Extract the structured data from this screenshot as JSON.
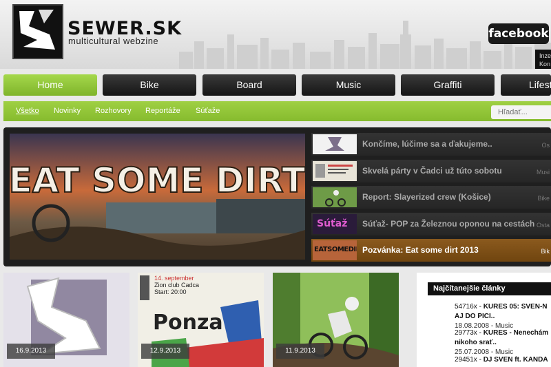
{
  "header": {
    "logo_title": "SEWER.SK",
    "logo_subtitle": "multicultural webzine",
    "facebook_label": "facebook",
    "side_tab_lines": [
      "Inze",
      "Kon"
    ]
  },
  "nav": {
    "items": [
      {
        "label": "Home",
        "active": true
      },
      {
        "label": "Bike",
        "active": false
      },
      {
        "label": "Board",
        "active": false
      },
      {
        "label": "Music",
        "active": false
      },
      {
        "label": "Graffiti",
        "active": false
      },
      {
        "label": "Lifest",
        "active": false
      }
    ]
  },
  "subnav": {
    "items": [
      {
        "label": "Všetko",
        "active": true
      },
      {
        "label": "Novinky",
        "active": false
      },
      {
        "label": "Rozhovory",
        "active": false
      },
      {
        "label": "Reportáže",
        "active": false
      },
      {
        "label": "Súťaže",
        "active": false
      }
    ],
    "search_placeholder": "Hľadať..."
  },
  "featured": {
    "image_text": "EAT SOME DIRT",
    "items": [
      {
        "title": "Končíme, lúčime sa a ďakujeme..",
        "category": "Os",
        "thumb": "logo"
      },
      {
        "title": "Skvelá párty v Čadci už túto sobotu",
        "category": "Musi",
        "thumb": "flyer"
      },
      {
        "title": "Report: Slayerized crew (Košice)",
        "category": "Bike",
        "thumb": "bike"
      },
      {
        "title": "Súťaž- POP za Železnou oponou na cestách",
        "category": "Osta",
        "thumb": "sutaz"
      },
      {
        "title": "Pozvánka: Eat some dirt 2013",
        "category": "Bik",
        "thumb": "dirt"
      }
    ],
    "thumb_texts": {
      "sutaz": "Súťaž",
      "dirt": "EATSOMEDIRT"
    }
  },
  "articles": [
    {
      "date": "16.9.2013",
      "image": "logo"
    },
    {
      "date": "12.9.2013",
      "image": "poster",
      "poster_lines": [
        "14. september",
        "Zion club Cadca",
        "Start: 20:00",
        "Ponza"
      ]
    },
    {
      "date": "11.9.2013",
      "image": "bike"
    }
  ],
  "popular": {
    "title": "Najčítanejšie články",
    "entries": [
      {
        "count": "54716x",
        "text": "KURES 05: SVEN-N",
        "line2": "AJ DO PICI..",
        "date": "18.08.2008",
        "category": "Music"
      },
      {
        "count": "29773x",
        "text": "KURES - Nenechám",
        "line2": "nikoho srať..",
        "date": "25.07.2008",
        "category": "Music"
      },
      {
        "count": "29451x",
        "text": "DJ SVEN ft. KANDA"
      }
    ]
  },
  "colors": {
    "accent_green": "#8dc535",
    "nav_dark": "#1d1d1d",
    "featured_active": "#7e4f16"
  }
}
